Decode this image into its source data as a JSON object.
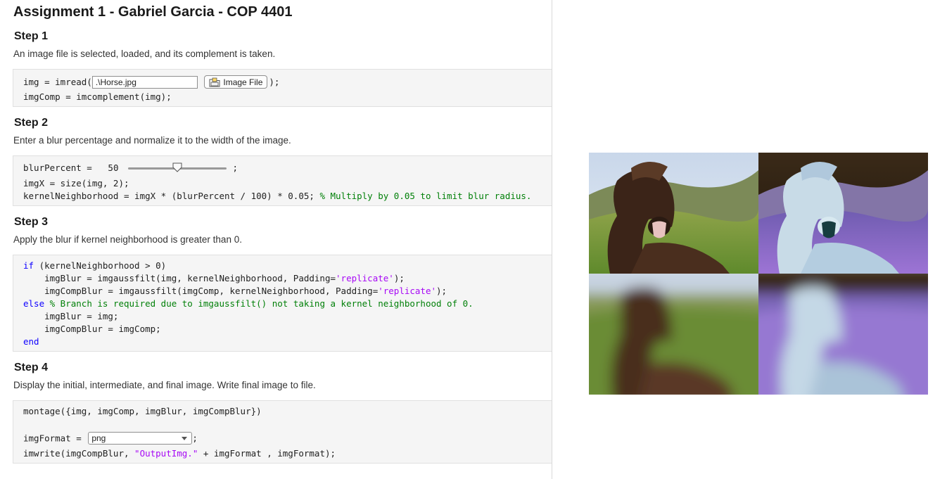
{
  "title": "Assignment 1 - Gabriel Garcia - COP 4401",
  "steps": [
    {
      "heading": "Step 1",
      "desc": "An image file is selected, loaded, and its complement is taken."
    },
    {
      "heading": "Step 2",
      "desc": "Enter a blur percentage and normalize it to the width of the image."
    },
    {
      "heading": "Step 3",
      "desc": "Apply the blur if kernel neighborhood is greater than 0."
    },
    {
      "heading": "Step 4",
      "desc": "Display the initial, intermediate, and final image. Write final image to file."
    }
  ],
  "code": {
    "s1_l1_pre": "img = imread(",
    "s1_file_value": ".\\Horse.jpg",
    "s1_button": "Image File",
    "s1_l1_post": ");",
    "s1_l2": "imgComp = imcomplement(img);",
    "s2_l1_pre": "blurPercent = ",
    "s2_value": "50",
    "s2_l1_post": ";",
    "s2_l2": "imgX = size(img, 2);",
    "s2_l3_code": "kernelNeighborhood = imgX * (blurPercent / 100) * 0.05; ",
    "s2_l3_cmt": "% Multiply by 0.05 to limit blur radius.",
    "s3_if_kw": "if",
    "s3_if_rest": " (kernelNeighborhood > 0)",
    "s3_l2_pre": "    imgBlur = imgaussfilt(img, kernelNeighborhood, Padding=",
    "s3_str": "'replicate'",
    "s3_l2_post": ");",
    "s3_l3_pre": "    imgCompBlur = imgaussfilt(imgComp, kernelNeighborhood, Padding=",
    "s3_l3_post": ");",
    "s3_else_kw": "else",
    "s3_else_cmt": " % Branch is required due to imgaussfilt() not taking a kernel neighborhood of 0.",
    "s3_l5": "    imgBlur = img;",
    "s3_l6": "    imgCompBlur = imgComp;",
    "s3_end_kw": "end",
    "s4_l1": "montage({img, imgComp, imgBlur, imgCompBlur})",
    "s4_l2_pre": "imgFormat = ",
    "s4_format_value": "png",
    "s4_l2_post": ";",
    "s4_l3_pre": "imwrite(imgCompBlur, ",
    "s4_l3_str": "\"OutputImg.\"",
    "s4_l3_post": " + imgFormat , imgFormat);"
  },
  "slider": {
    "value": 50,
    "min": 0,
    "max": 100
  },
  "output": {
    "panels": [
      "original-horse",
      "complement-horse",
      "blurred-horse",
      "blurred-complement-horse"
    ]
  },
  "colors": {
    "keyword": "#0e00ff",
    "string": "#a709f5",
    "comment": "#028009",
    "code_bg": "#f5f5f5"
  }
}
